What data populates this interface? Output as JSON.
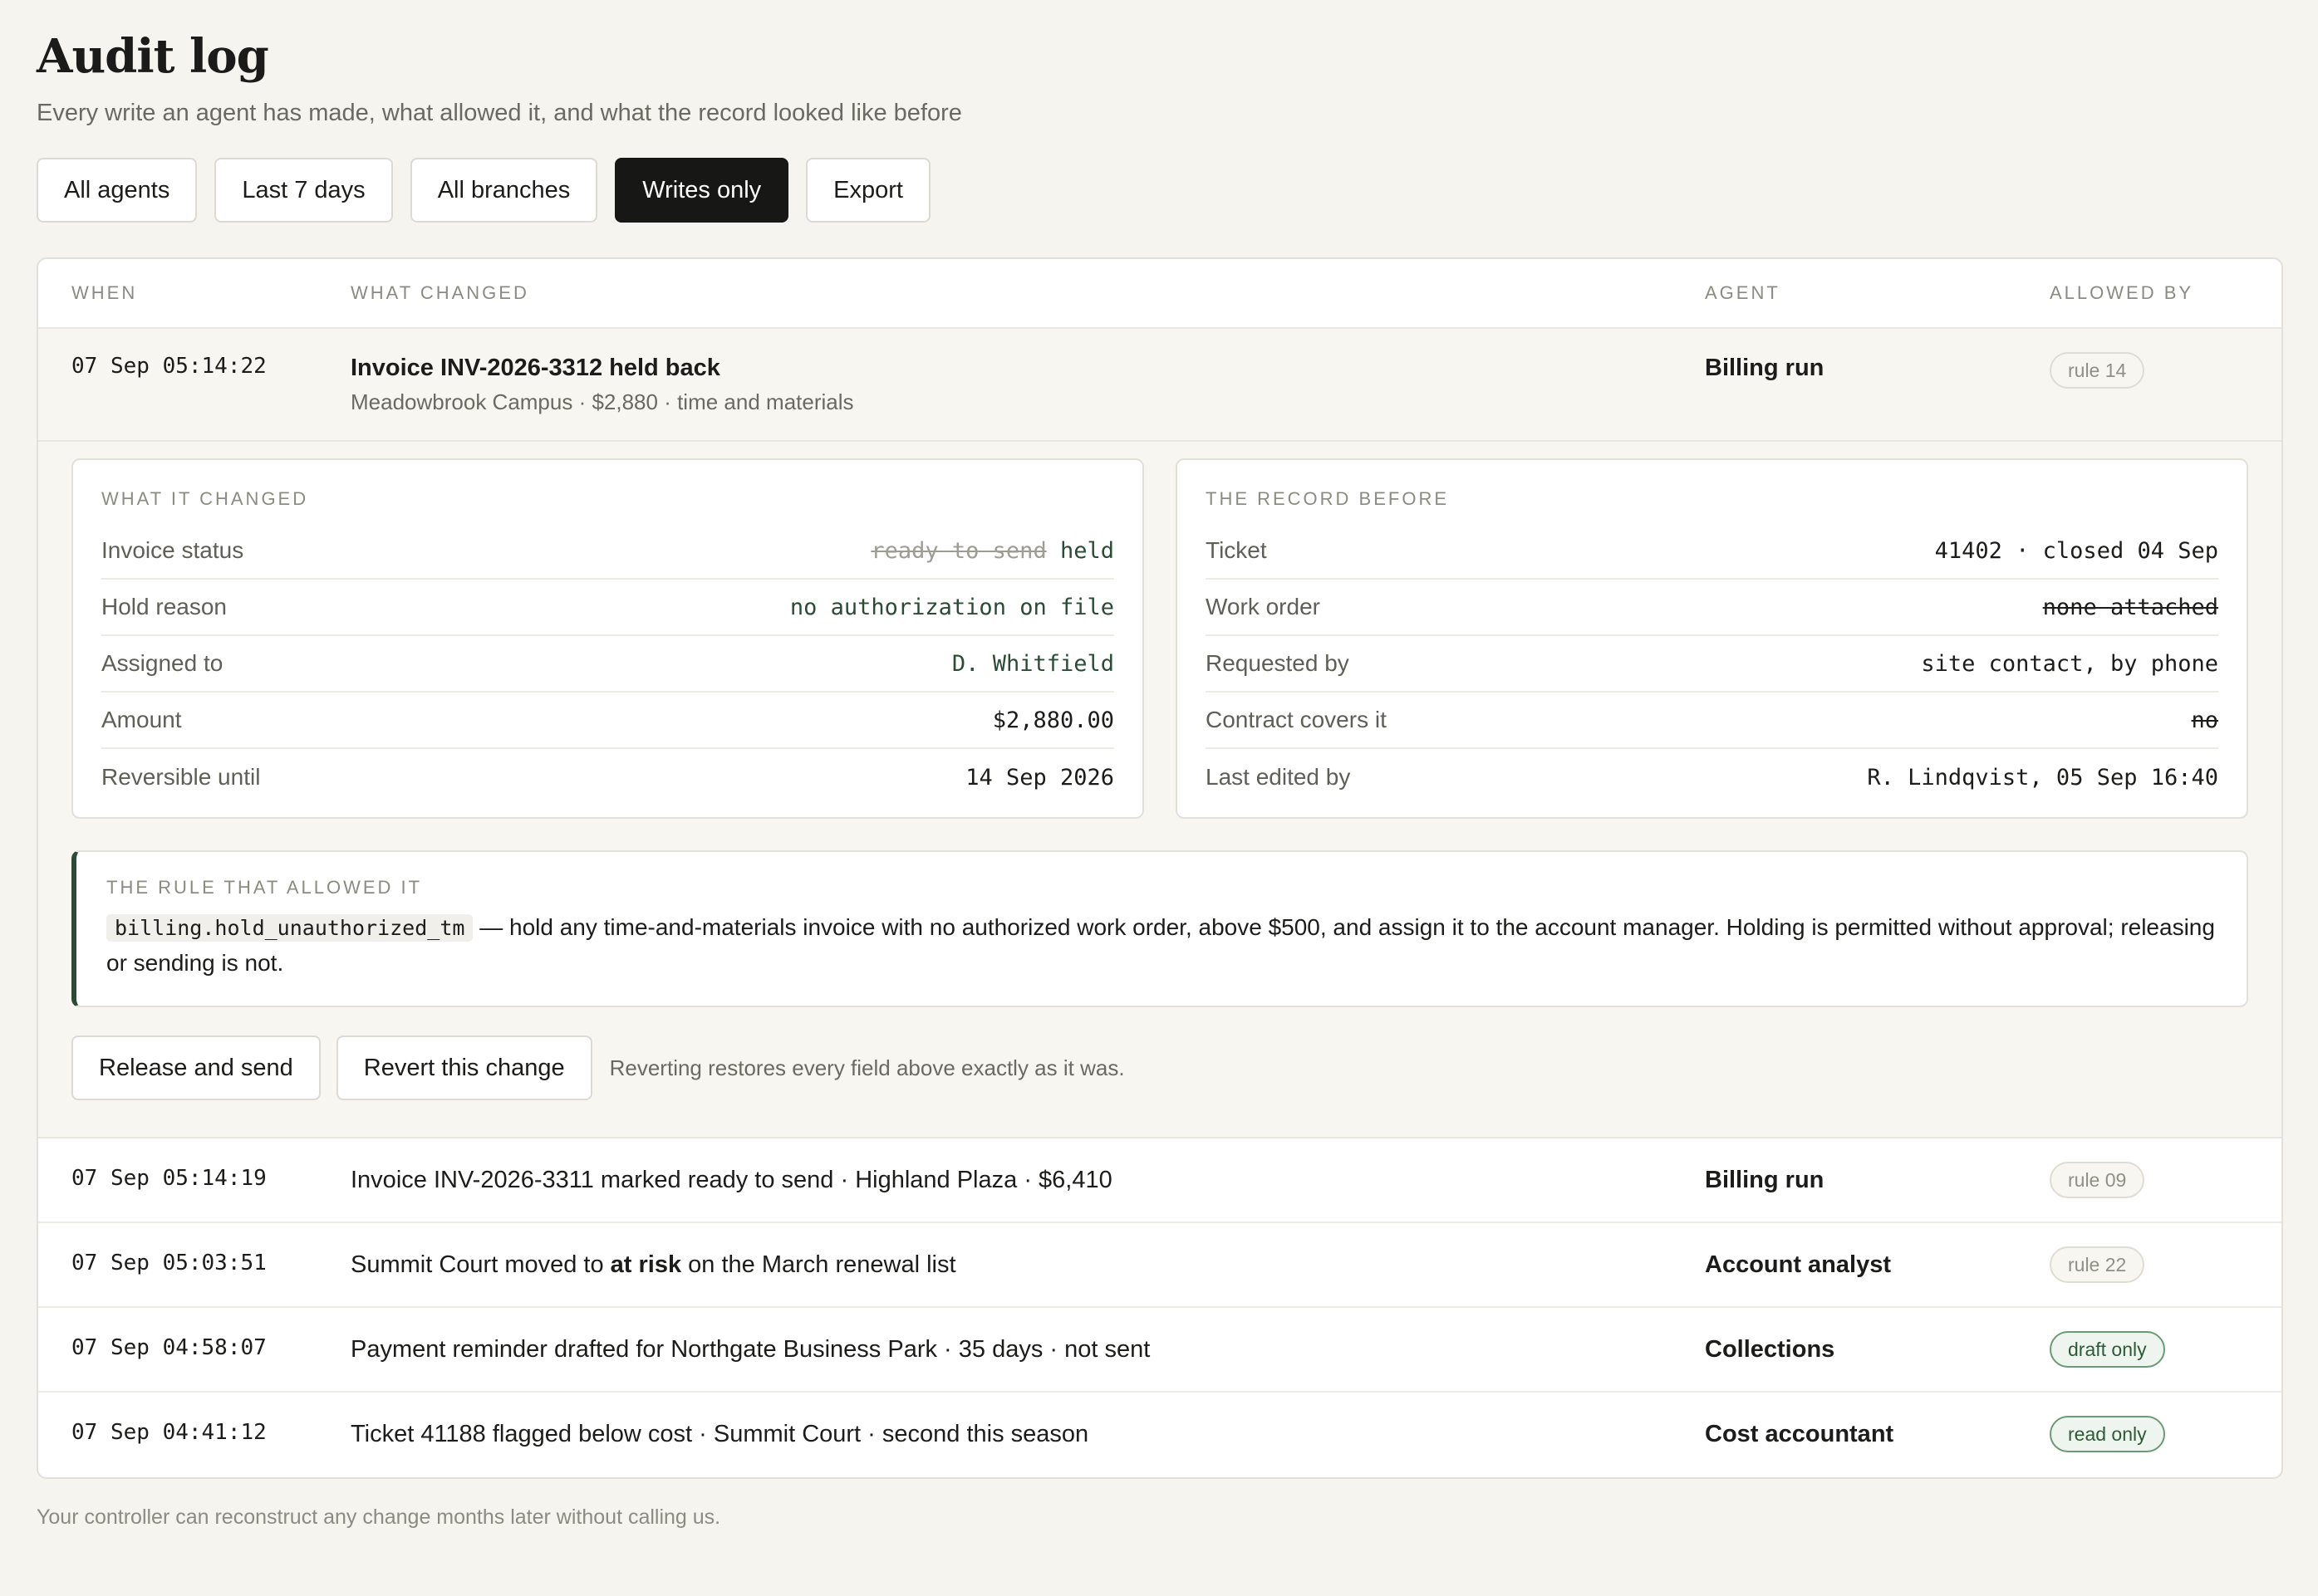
{
  "page": {
    "title": "Audit log",
    "subtitle": "Every write an agent has made, what allowed it, and what the record looked like before"
  },
  "filters": [
    "All agents",
    "Last 7 days",
    "All branches",
    "Writes only",
    "Export"
  ],
  "active_filter": "Writes only",
  "table": {
    "headers": {
      "when": "WHEN",
      "what": "WHAT CHANGED",
      "agent": "AGENT",
      "allowed": "ALLOWED BY"
    },
    "expanded": {
      "when": "07 Sep 05:14:22",
      "title": "Invoice INV-2026-3312 held back",
      "subtitle": "Meadowbrook Campus · $2,880 · time and materials",
      "agent": "Billing run",
      "allowed": "rule 14",
      "changed_panel": {
        "heading": "WHAT IT CHANGED",
        "rows": [
          {
            "label": "Invoice status",
            "old": "ready to send",
            "value": "held"
          },
          {
            "label": "Hold reason",
            "value": "no authorization on file"
          },
          {
            "label": "Assigned to",
            "value": "D. Whitfield"
          },
          {
            "label": "Amount",
            "value": "$2,880.00"
          },
          {
            "label": "Reversible until",
            "value": "14 Sep 2026"
          }
        ]
      },
      "before_panel": {
        "heading": "THE RECORD BEFORE",
        "rows": [
          {
            "label": "Ticket",
            "value": "41402 · closed 04 Sep"
          },
          {
            "label": "Work order",
            "value": "none attached"
          },
          {
            "label": "Requested by",
            "value": "site contact, by phone"
          },
          {
            "label": "Contract covers it",
            "value": "no"
          },
          {
            "label": "Last edited by",
            "value": "R. Lindqvist, 05 Sep 16:40"
          }
        ]
      },
      "rule": {
        "heading": "THE RULE THAT ALLOWED IT",
        "code": "billing.hold_unauthorized_tm",
        "text": "— hold any time-and-materials invoice with no authorized work order, above $500, and assign it to the account manager. Holding is permitted without approval; releasing or sending is not."
      },
      "actions": {
        "release": "Release and send",
        "revert": "Revert this change",
        "note": "Reverting restores every field above exactly as it was."
      }
    },
    "rows": [
      {
        "when": "07 Sep 05:14:19",
        "what": "Invoice INV-2026-3311 marked ready to send · Highland Plaza · $6,410",
        "agent": "Billing run",
        "allowed": "rule 09",
        "style": "rule"
      },
      {
        "when": "07 Sep 05:03:51",
        "what_pre": "Summit Court moved to ",
        "what_bold": "at risk",
        "what_post": " on the March renewal list",
        "agent": "Account analyst",
        "allowed": "rule 22",
        "style": "rule"
      },
      {
        "when": "07 Sep 04:58:07",
        "what": "Payment reminder drafted for Northgate Business Park · 35 days · not sent",
        "agent": "Collections",
        "allowed": "draft only",
        "style": "green"
      },
      {
        "when": "07 Sep 04:41:12",
        "what": "Ticket 41188 flagged below cost · Summit Court · second this season",
        "agent": "Cost accountant",
        "allowed": "read only",
        "style": "green"
      }
    ]
  },
  "footer": "Your controller can reconstruct any change months later without calling us."
}
